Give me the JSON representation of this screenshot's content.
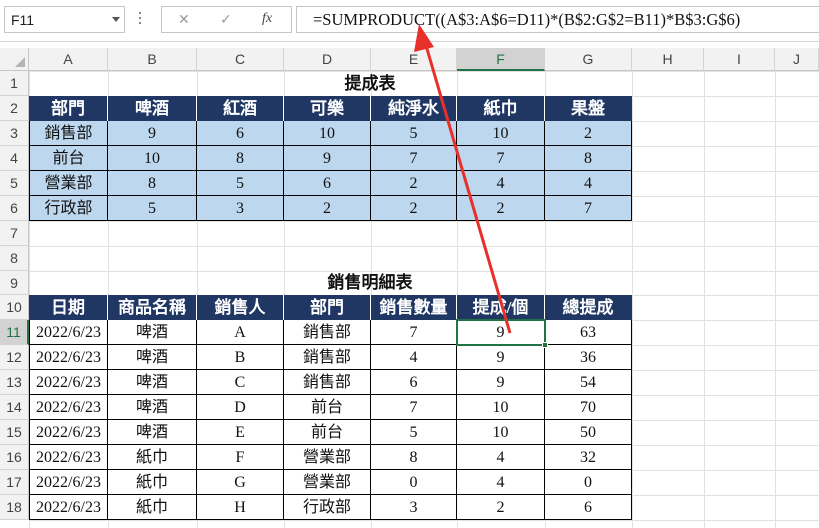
{
  "formula_bar": {
    "name_box": "F11",
    "cancel_icon": "✕",
    "enter_icon": "✓",
    "fx_label": "fx",
    "formula": "=SUMPRODUCT((A$3:A$6=D11)*(B$2:G$2=B11)*B$3:G$6)"
  },
  "columns": [
    "A",
    "B",
    "C",
    "D",
    "E",
    "F",
    "G",
    "H",
    "I",
    "J"
  ],
  "selected_column": "F",
  "rows": [
    "1",
    "2",
    "3",
    "4",
    "5",
    "6",
    "7",
    "8",
    "9",
    "10",
    "11",
    "12",
    "13",
    "14",
    "15",
    "16",
    "17",
    "18"
  ],
  "selected_row": "11",
  "table1": {
    "title": "提成表",
    "headers": [
      "部門",
      "啤酒",
      "紅酒",
      "可樂",
      "純淨水",
      "紙巾",
      "果盤"
    ],
    "rows": [
      [
        "銷售部",
        "9",
        "6",
        "10",
        "5",
        "10",
        "2"
      ],
      [
        "前台",
        "10",
        "8",
        "9",
        "7",
        "7",
        "8"
      ],
      [
        "營業部",
        "8",
        "5",
        "6",
        "2",
        "4",
        "4"
      ],
      [
        "行政部",
        "5",
        "3",
        "2",
        "2",
        "2",
        "7"
      ]
    ]
  },
  "table2": {
    "title": "銷售明細表",
    "headers": [
      "日期",
      "商品名稱",
      "銷售人",
      "部門",
      "銷售數量",
      "提成/個",
      "總提成"
    ],
    "rows": [
      [
        "2022/6/23",
        "啤酒",
        "A",
        "銷售部",
        "7",
        "9",
        "63"
      ],
      [
        "2022/6/23",
        "啤酒",
        "B",
        "銷售部",
        "4",
        "9",
        "36"
      ],
      [
        "2022/6/23",
        "啤酒",
        "C",
        "銷售部",
        "6",
        "9",
        "54"
      ],
      [
        "2022/6/23",
        "啤酒",
        "D",
        "前台",
        "7",
        "10",
        "70"
      ],
      [
        "2022/6/23",
        "啤酒",
        "E",
        "前台",
        "5",
        "10",
        "50"
      ],
      [
        "2022/6/23",
        "紙巾",
        "F",
        "營業部",
        "8",
        "4",
        "32"
      ],
      [
        "2022/6/23",
        "紙巾",
        "G",
        "營業部",
        "0",
        "4",
        "0"
      ],
      [
        "2022/6/23",
        "紙巾",
        "H",
        "行政部",
        "3",
        "2",
        "6"
      ]
    ]
  },
  "colors": {
    "header_fill": "#203764",
    "table1_fill": "#bdd7ee",
    "selection": "#217346",
    "arrow": "#e8302b"
  }
}
